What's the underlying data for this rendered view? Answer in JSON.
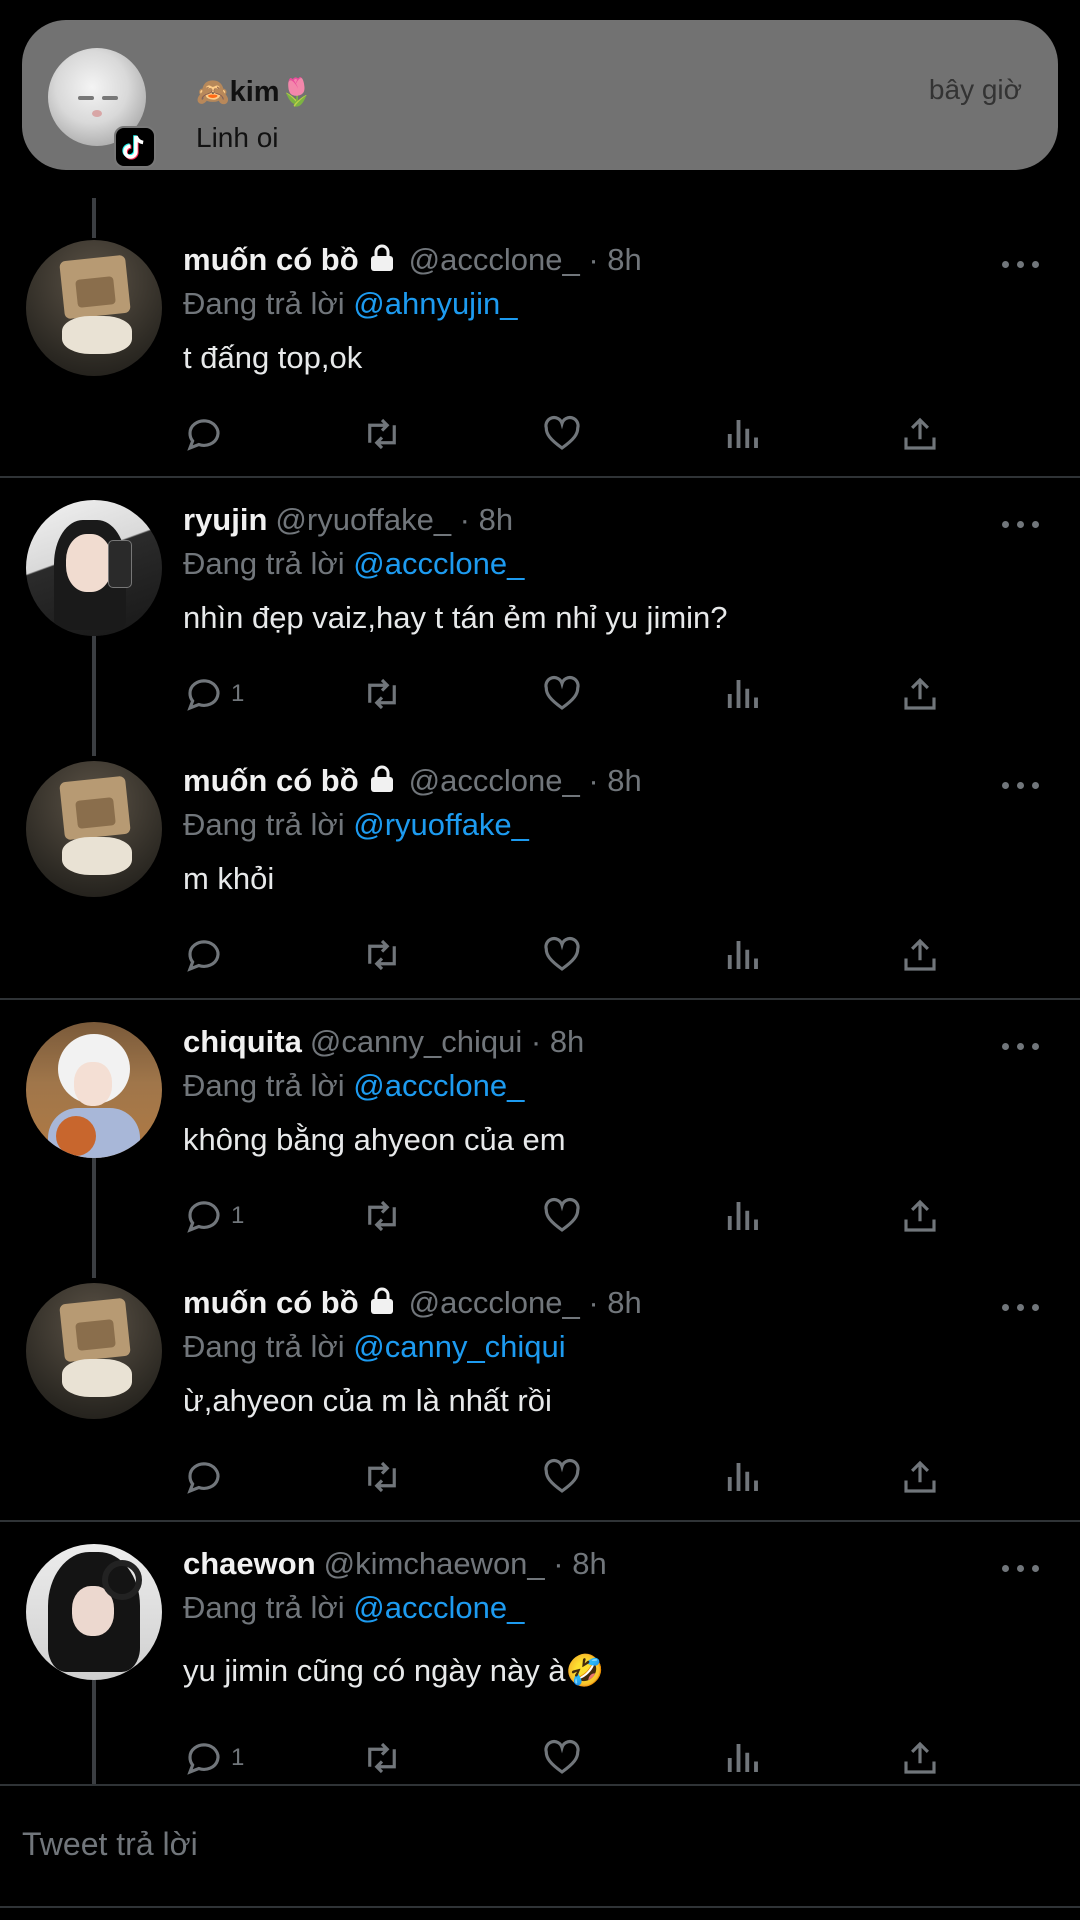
{
  "notification": {
    "sender_emoji_left": "🙈",
    "sender_name": "kim",
    "sender_emoji_right": "🌷",
    "message": "Linh oi",
    "time": "bây giờ",
    "app_icon": "tiktok-icon"
  },
  "tweets": [
    {
      "name": "muốn có bồ",
      "locked": true,
      "handle": "@accclone_ · 8h",
      "replying_label": "Đang trả lời",
      "replying_to": "@ahnyujin_",
      "text": "t đấng top,ok",
      "reply_count": ""
    },
    {
      "name": "ryujin",
      "locked": false,
      "handle": "@ryuoffake_ · 8h",
      "replying_label": "Đang trả lời",
      "replying_to": "@accclone_",
      "text": "nhìn đẹp vaiz,hay t tán ẻm nhỉ yu jimin?",
      "reply_count": "1"
    },
    {
      "name": "muốn có bồ",
      "locked": true,
      "handle": "@accclone_ · 8h",
      "replying_label": "Đang trả lời",
      "replying_to": "@ryuoffake_",
      "text": "m khỏi",
      "reply_count": ""
    },
    {
      "name": "chiquita",
      "locked": false,
      "handle": "@canny_chiqui · 8h",
      "replying_label": "Đang trả lời",
      "replying_to": "@accclone_",
      "text": "không bằng ahyeon của em",
      "reply_count": "1"
    },
    {
      "name": "muốn có bồ",
      "locked": true,
      "handle": "@accclone_ · 8h",
      "replying_label": "Đang trả lời",
      "replying_to": "@canny_chiqui",
      "text": "ừ,ahyeon của m là nhất rồi",
      "reply_count": ""
    },
    {
      "name": "chaewon",
      "locked": false,
      "handle": "@kimchaewon_ · 8h",
      "replying_label": "Đang trả lời",
      "replying_to": "@accclone_",
      "text": "yu jimin cũng có ngày này à🤣",
      "reply_count": "1"
    }
  ],
  "compose": {
    "placeholder": "Tweet trả lời"
  },
  "colors": {
    "background": "#000000",
    "mention": "#1d9bf0",
    "secondary_text": "#71767b"
  }
}
